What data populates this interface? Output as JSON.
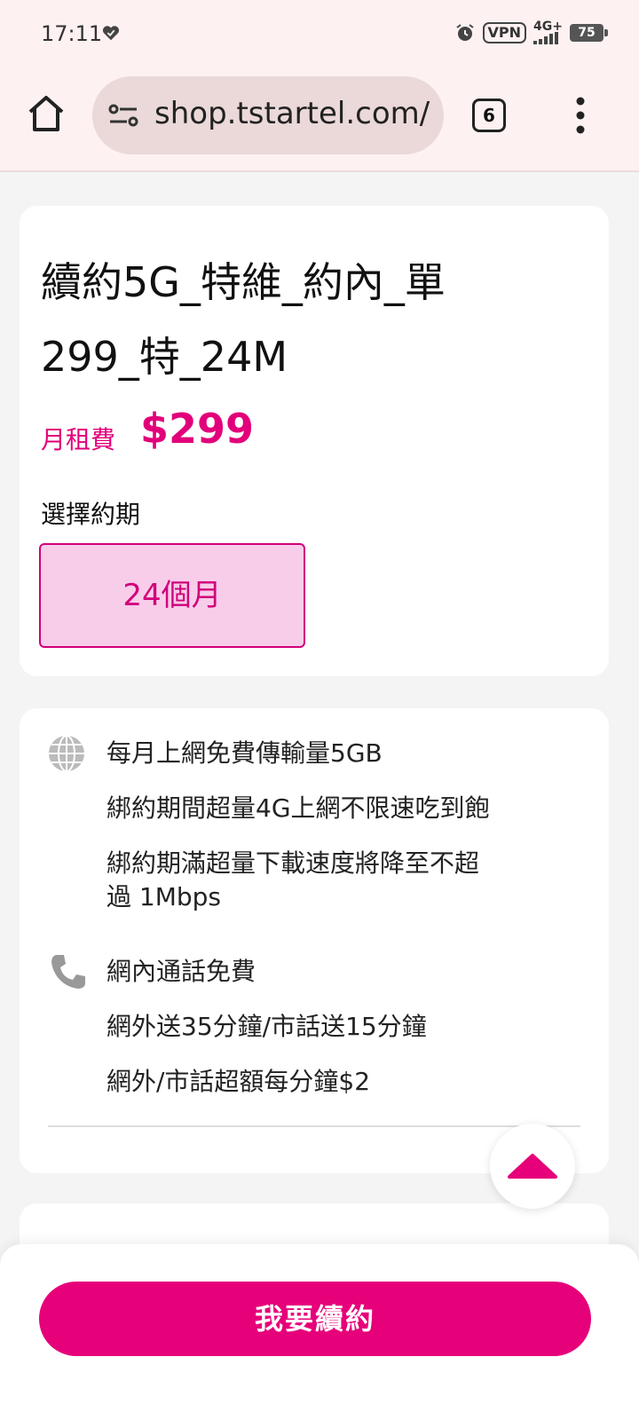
{
  "status_bar": {
    "time": "17:11",
    "vpn": "VPN",
    "network": "4G+",
    "battery": "75"
  },
  "browser": {
    "url": "shop.tstartel.com/",
    "tab_count": "6"
  },
  "plan": {
    "title_line1": "續約5G_特維_約內_單",
    "title_line2": "299_特_24M",
    "price_label": "月租費",
    "price": "$299",
    "period_label": "選擇約期",
    "period_option": "24個月"
  },
  "features": {
    "data": [
      "每月上網免費傳輸量5GB",
      "綁約期間超量4G上網不限速吃到飽",
      "綁約期滿超量下載速度將降至不超",
      "過 1Mbps"
    ],
    "voice": [
      "網內通話免費",
      "網外送35分鐘/市話送15分鐘",
      "網外/市話超額每分鐘$2"
    ]
  },
  "cta": {
    "label": "我要續約"
  },
  "colors": {
    "brand": "#e6007a",
    "option_bg": "#f8cdea",
    "chrome_bg": "#fdf2f1"
  }
}
